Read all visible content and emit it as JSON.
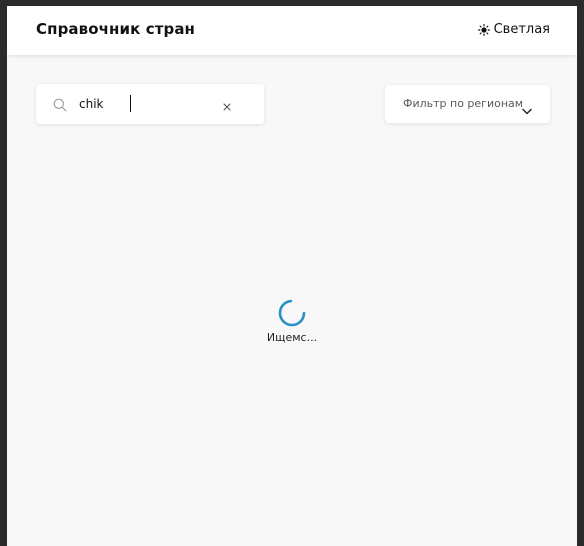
{
  "header": {
    "title": "Справочник стран",
    "theme_toggle": {
      "icon": "sun-icon",
      "label": "Светлая"
    }
  },
  "search": {
    "icon": "search-icon",
    "value": "chik",
    "clear_icon": "close-icon"
  },
  "region_filter": {
    "label": "Фильтр по регионам",
    "icon": "chevron-down-icon"
  },
  "loading": {
    "icon": "spinner-icon",
    "text": "Ищемс..."
  },
  "colors": {
    "spinner": "#2a8fc4",
    "background": "#f8f8f8"
  }
}
